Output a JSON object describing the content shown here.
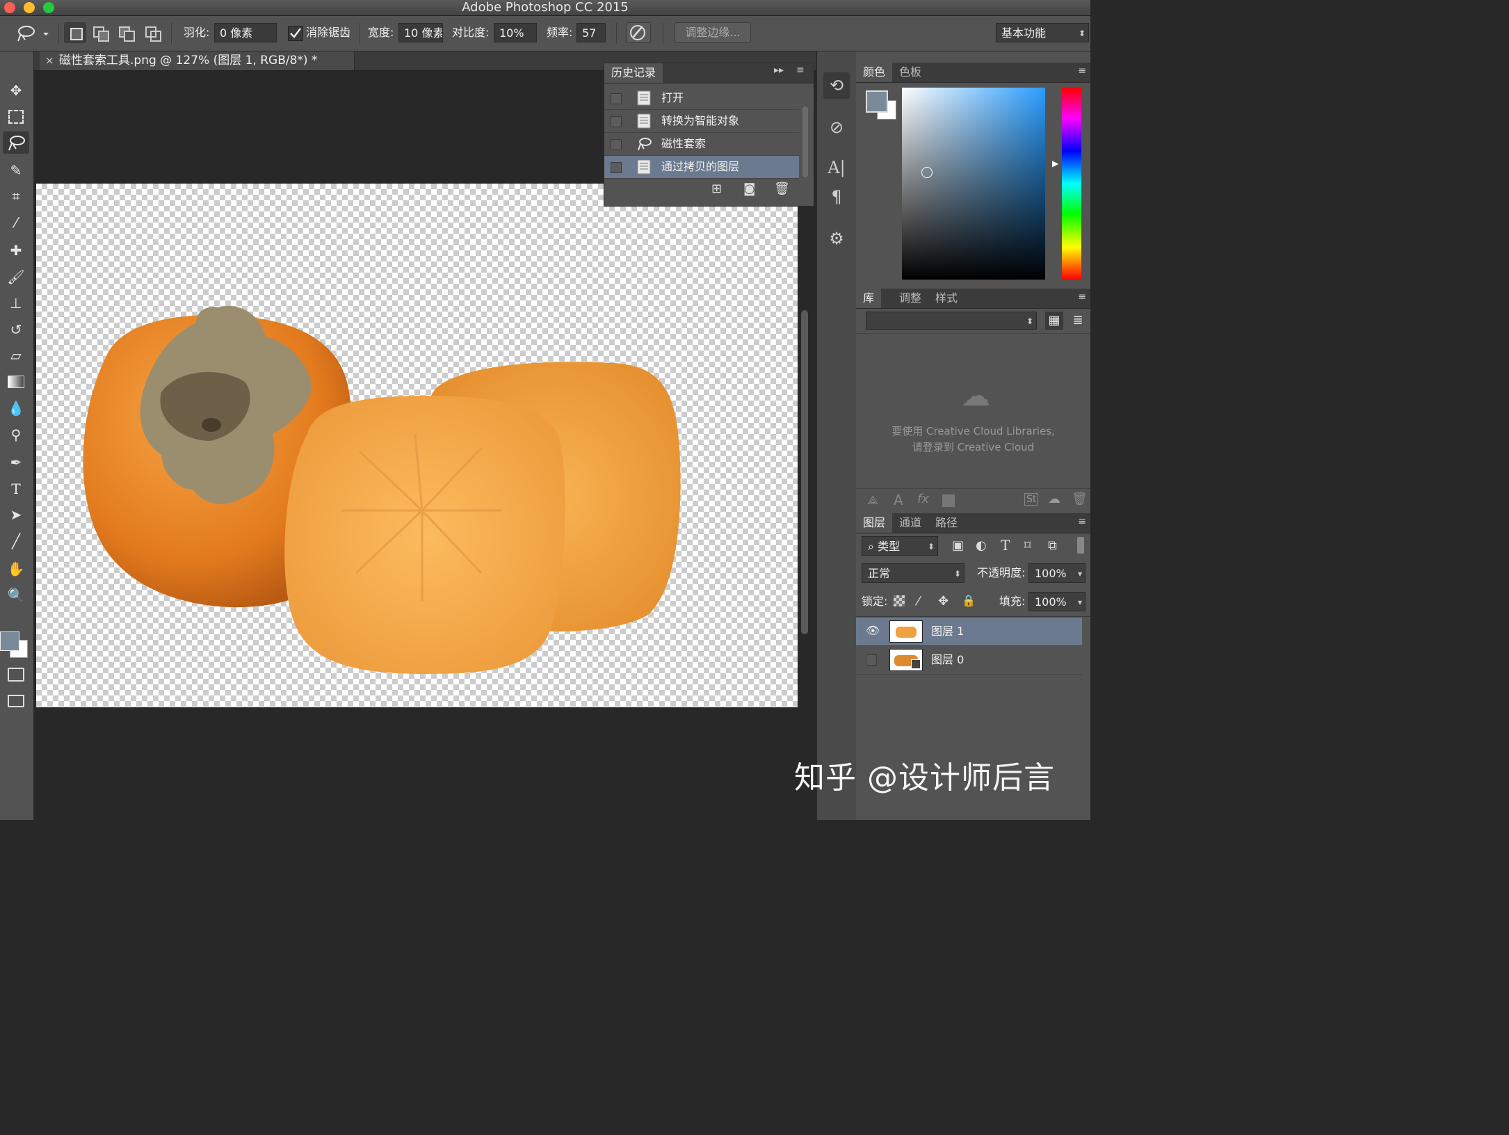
{
  "window": {
    "title": "Adobe Photoshop CC 2015"
  },
  "options_bar": {
    "feather_label": "羽化:",
    "feather_value": "0 像素",
    "antialias_checked": true,
    "antialias_label": "消除锯齿",
    "width_label": "宽度:",
    "width_value": "10 像素",
    "contrast_label": "对比度:",
    "contrast_value": "10%",
    "frequency_label": "频率:",
    "frequency_value": "57",
    "refine_edge_label": "调整边缘...",
    "workspace_value": "基本功能"
  },
  "document": {
    "tab_title": "磁性套索工具.png @ 127% (图层 1, RGB/8*) *"
  },
  "history_panel": {
    "title": "历史记录",
    "items": [
      {
        "label": "打开",
        "icon": "document-icon",
        "selected": false
      },
      {
        "label": "转换为智能对象",
        "icon": "document-icon",
        "selected": false
      },
      {
        "label": "磁性套索",
        "icon": "magnetic-lasso-icon",
        "selected": false
      },
      {
        "label": "通过拷贝的图层",
        "icon": "document-icon",
        "selected": true
      }
    ]
  },
  "color_panel": {
    "tabs": [
      "颜色",
      "色板"
    ],
    "active_tab": "颜色",
    "foreground": "#7a8a9a",
    "background": "#ffffff",
    "picker_hue": "#2a9dff"
  },
  "libraries_panel": {
    "tabs": [
      "库",
      "调整",
      "样式"
    ],
    "active_tab": "库",
    "message_line1": "要使用 Creative Cloud Libraries,",
    "message_line2": "请登录到 Creative Cloud"
  },
  "layers_panel": {
    "tabs": [
      "图层",
      "通道",
      "路径"
    ],
    "active_tab": "图层",
    "filter_kind": "类型",
    "blend_mode": "正常",
    "opacity_label": "不透明度:",
    "opacity_value": "100%",
    "lock_label": "锁定:",
    "fill_label": "填充:",
    "fill_value": "100%",
    "layers": [
      {
        "name": "图层 1",
        "visible": true,
        "selected": true
      },
      {
        "name": "图层 0",
        "visible": false,
        "selected": false
      }
    ]
  },
  "watermark": "知乎 @设计师后言"
}
